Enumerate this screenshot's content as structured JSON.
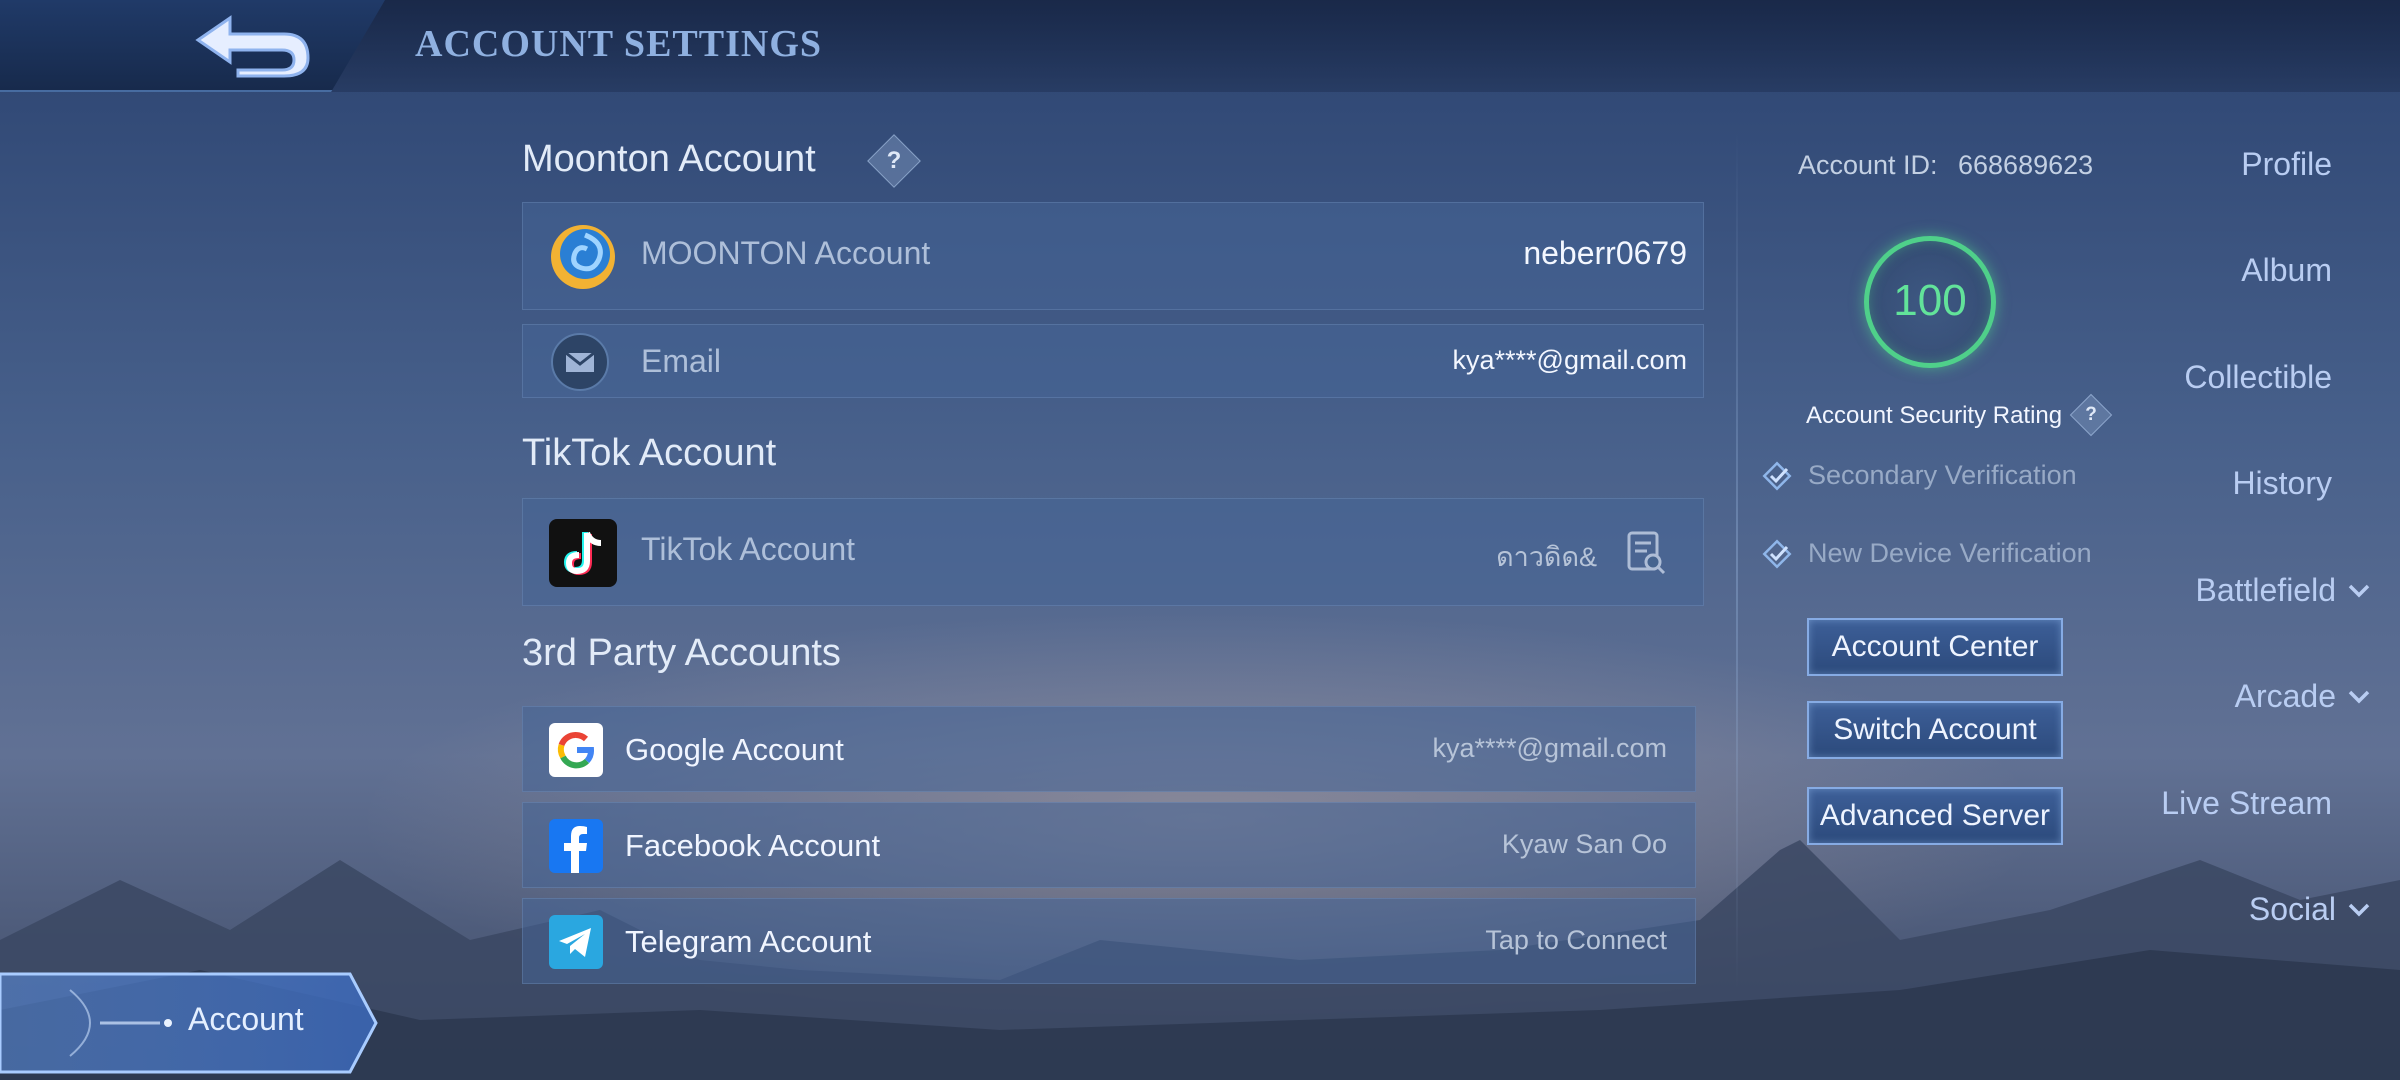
{
  "header": {
    "title": "ACCOUNT SETTINGS",
    "back_icon": "back-arrow-icon"
  },
  "sidebar": {
    "items": [
      {
        "label": "Profile",
        "has_chevron": false
      },
      {
        "label": "Album",
        "has_chevron": false
      },
      {
        "label": "Collectible",
        "has_chevron": false
      },
      {
        "label": "History",
        "has_chevron": false
      },
      {
        "label": "Battlefield",
        "has_chevron": true
      },
      {
        "label": "Arcade",
        "has_chevron": true
      },
      {
        "label": "Live Stream",
        "has_chevron": false
      },
      {
        "label": "Social",
        "has_chevron": true
      }
    ],
    "active": {
      "label": "Account"
    }
  },
  "moonton": {
    "title": "Moonton Account",
    "account_row": {
      "label": "MOONTON Account",
      "value": "neberr0679",
      "icon": "moonton-logo-icon"
    },
    "email_row": {
      "label": "Email",
      "value": "kya****@gmail.com",
      "icon": "mail-icon"
    }
  },
  "tiktok": {
    "title": "TikTok Account",
    "row": {
      "label": "TikTok Account",
      "value": "ดาวดิด&",
      "icon": "tiktok-logo-icon",
      "action_icon": "document-search-icon"
    }
  },
  "third_party": {
    "title": "3rd Party Accounts",
    "rows": [
      {
        "label": "Google Account",
        "value": "kya****@gmail.com",
        "icon": "google-logo-icon"
      },
      {
        "label": "Facebook Account",
        "value": "Kyaw San Oo",
        "icon": "facebook-logo-icon"
      },
      {
        "label": "Telegram Account",
        "value": "Tap to Connect",
        "icon": "telegram-logo-icon"
      }
    ]
  },
  "right_panel": {
    "account_id_label": "Account ID:",
    "account_id_value": "668689623",
    "security_rating": "100",
    "security_label": "Account Security Rating",
    "verifications": [
      "Secondary Verification",
      "New Device Verification"
    ],
    "buttons": [
      "Account Center",
      "Switch Account",
      "Advanced Server"
    ]
  },
  "colors": {
    "accent": "#86abe4",
    "rating_green": "#4fd08a",
    "row_bg": "#46648f"
  }
}
